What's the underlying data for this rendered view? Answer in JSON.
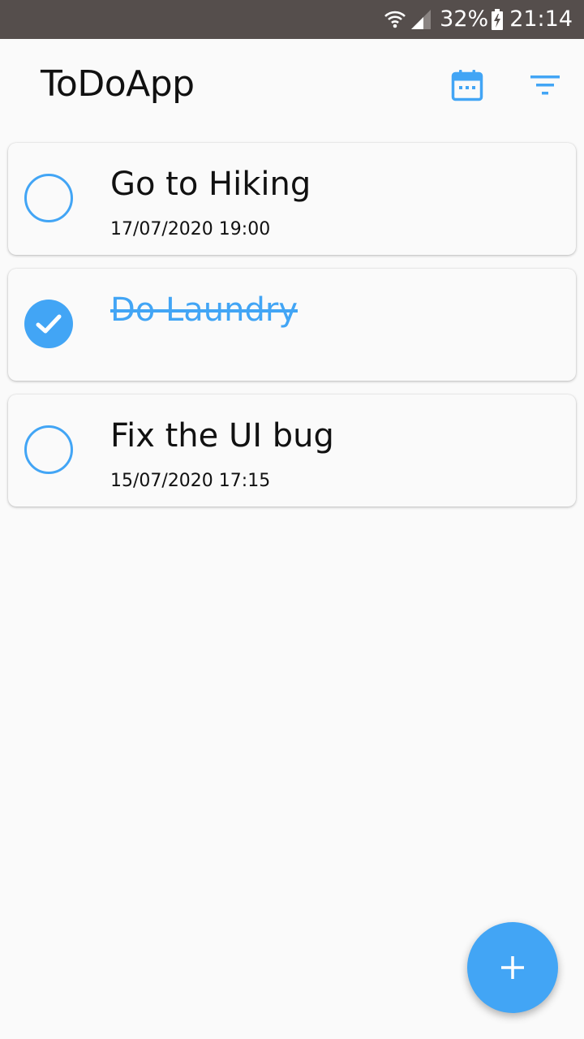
{
  "status_bar": {
    "battery_percent": "32%",
    "time": "21:14",
    "icons": [
      "wifi-icon",
      "cell-signal-icon",
      "battery-charging-icon"
    ]
  },
  "app_bar": {
    "title": "ToDoApp",
    "icons": [
      "calendar-icon",
      "filter-icon"
    ]
  },
  "tasks": [
    {
      "title": "Go to Hiking",
      "date": "17/07/2020 19:00",
      "completed": false
    },
    {
      "title": "Do Laundry",
      "date": "",
      "completed": true
    },
    {
      "title": "Fix the UI bug",
      "date": "15/07/2020 17:15",
      "completed": false
    }
  ],
  "fab": {
    "icon": "plus-icon"
  },
  "colors": {
    "accent": "#42a5f5",
    "status_bar": "#554e4c",
    "background": "#fafafa",
    "text": "#111111"
  }
}
